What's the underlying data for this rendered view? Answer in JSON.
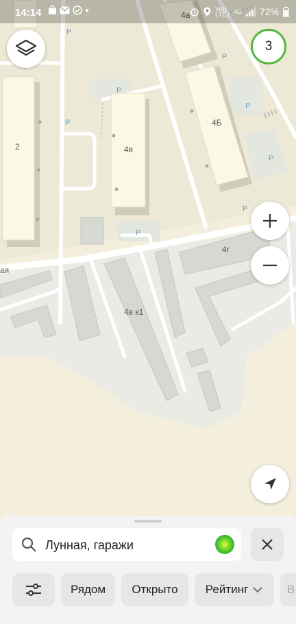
{
  "status_bar": {
    "time": "14:14",
    "volte_top": "Vo))",
    "volte_bottom": "LTE2",
    "network": "4G",
    "battery": "72%"
  },
  "map": {
    "street_label": "ая",
    "parking_label": "P",
    "buildings": [
      "4a",
      "4Б",
      "4в",
      "2",
      "4г",
      "4в к1"
    ]
  },
  "controls": {
    "counter": "3",
    "layers_icon": "layers-icon",
    "zoom_in": "+",
    "zoom_out": "−",
    "locate_icon": "navigation-arrow-icon"
  },
  "search": {
    "query": "Лунная, гаражи",
    "search_icon": "search-icon",
    "assistant_icon": "alice-icon",
    "close_icon": "close-icon"
  },
  "filters": {
    "filter_icon": "sliders-icon",
    "chips": [
      "Рядом",
      "Открыто",
      "Рейтинг"
    ],
    "partial_chip": "В"
  }
}
